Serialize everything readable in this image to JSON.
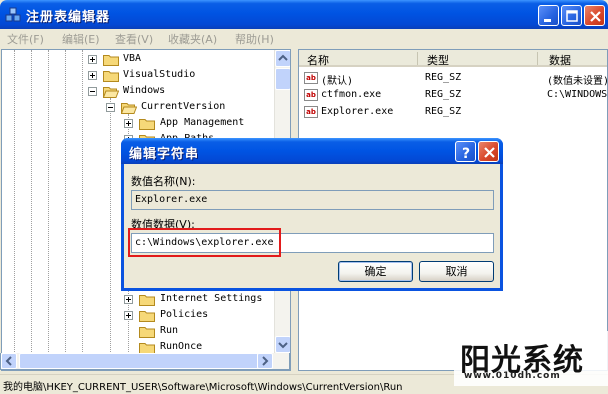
{
  "window": {
    "title": "注册表编辑器"
  },
  "menu": [
    {
      "label": "文件(F)"
    },
    {
      "label": "编辑(E)"
    },
    {
      "label": "查看(V)"
    },
    {
      "label": "收藏夹(A)"
    },
    {
      "label": "帮助(H)"
    }
  ],
  "tree": {
    "items": [
      {
        "label": "VBA"
      },
      {
        "label": "VisualStudio"
      },
      {
        "label": "Windows"
      },
      {
        "label": "CurrentVersion"
      },
      {
        "label": "App Management"
      },
      {
        "label": "App Paths"
      },
      {
        "label": "Internet Settings"
      },
      {
        "label": "Policies"
      },
      {
        "label": "Run"
      },
      {
        "label": "RunOnce"
      }
    ]
  },
  "list": {
    "columns": [
      "名称",
      "类型",
      "数据"
    ],
    "rows": [
      {
        "name": "(默认)",
        "type": "REG_SZ",
        "data": "(数值未设置)"
      },
      {
        "name": "ctfmon.exe",
        "type": "REG_SZ",
        "data": "C:\\WINDOWS"
      },
      {
        "name": "Explorer.exe",
        "type": "REG_SZ",
        "data": ""
      }
    ]
  },
  "status": {
    "path": "我的电脑\\HKEY_CURRENT_USER\\Software\\Microsoft\\Windows\\CurrentVersion\\Run"
  },
  "dialog": {
    "title": "编辑字符串",
    "name_label": "数值名称(N):",
    "name_value": "Explorer.exe",
    "data_label": "数值数据(V):",
    "data_value": "c:\\Windows\\explorer.exe",
    "ok_label": "确定",
    "cancel_label": "取消"
  },
  "watermark": {
    "brand": "阳光系统",
    "site": "www.010dh.com"
  },
  "colors": {
    "titlebar": "#0054e3",
    "highlight": "#e21b1b",
    "window_bg": "#ece9d8"
  }
}
